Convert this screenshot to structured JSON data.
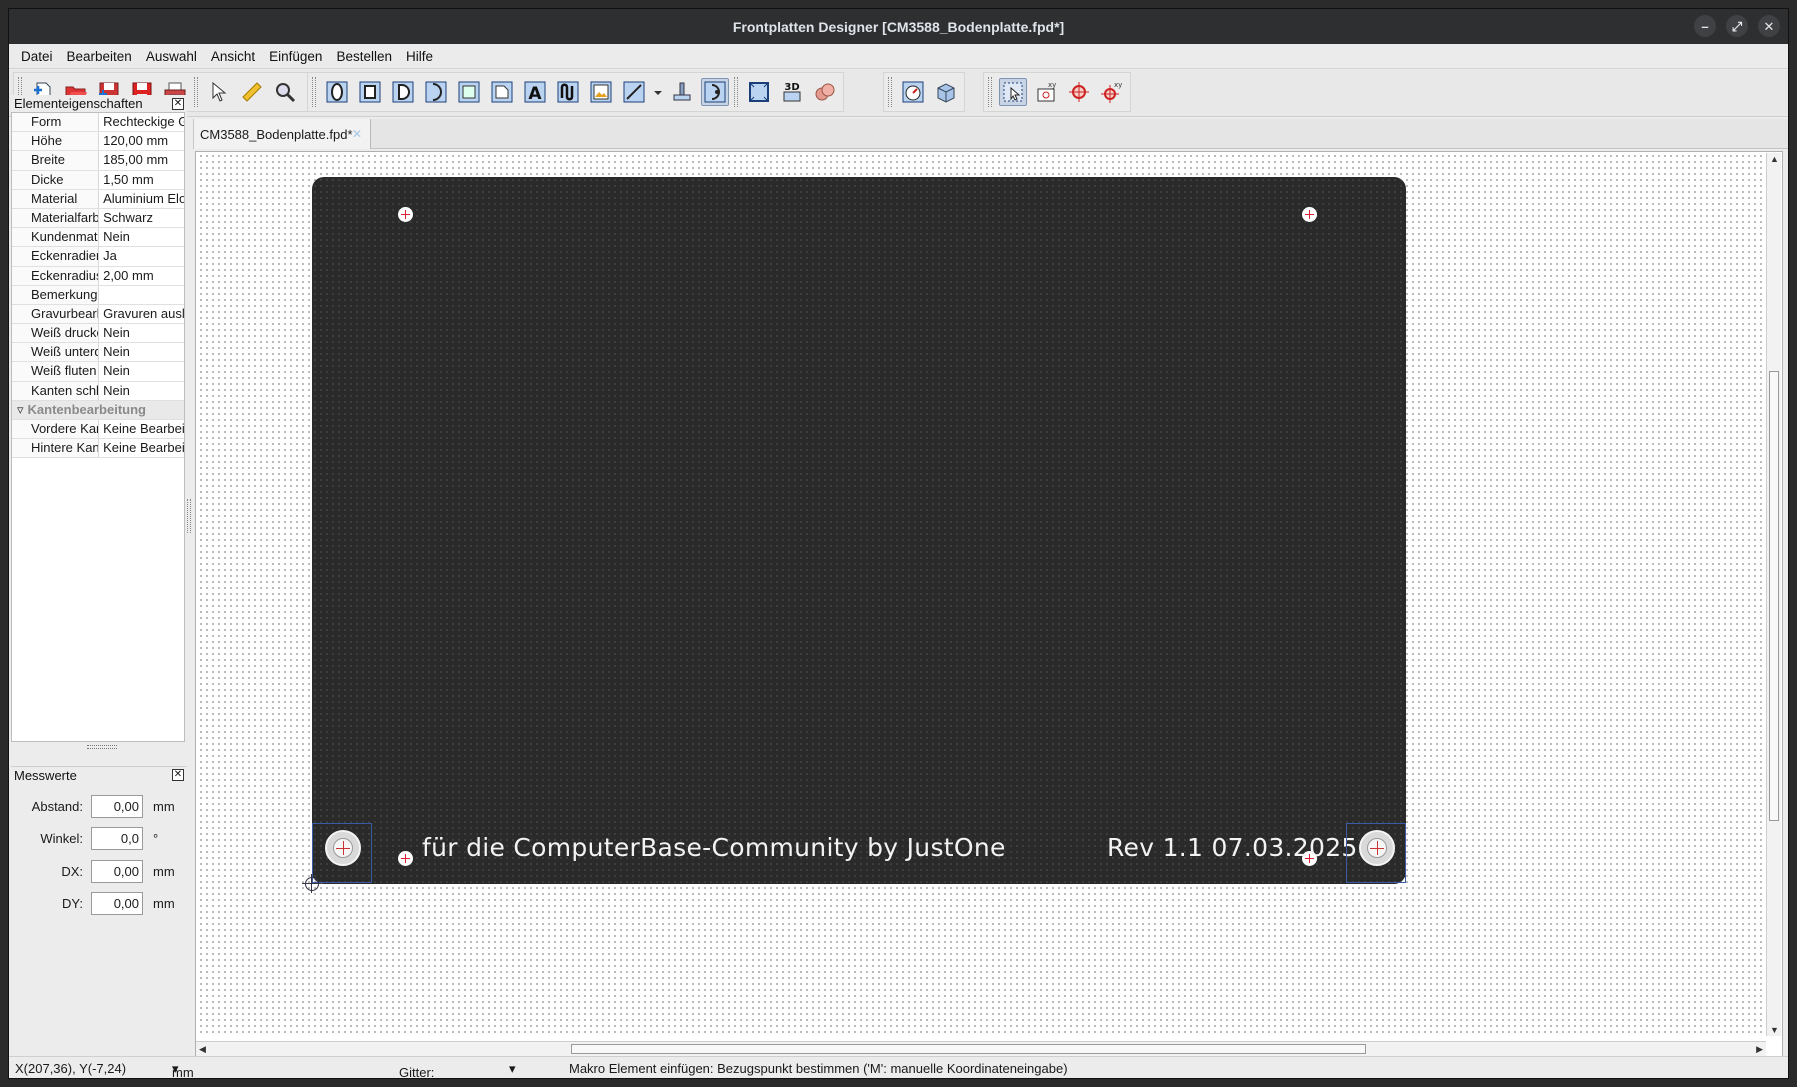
{
  "window": {
    "title": "Frontplatten Designer [CM3588_Bodenplatte.fpd*]"
  },
  "menu": [
    "Datei",
    "Bearbeiten",
    "Auswahl",
    "Ansicht",
    "Einfügen",
    "Bestellen",
    "Hilfe"
  ],
  "properties_panel": {
    "title": "Elementeigenschaften",
    "rows": [
      {
        "key": "Form",
        "value": "Rechteckige G"
      },
      {
        "key": "Höhe",
        "value": "120,00 mm"
      },
      {
        "key": "Breite",
        "value": "185,00 mm"
      },
      {
        "key": "Dicke",
        "value": "1,50 mm"
      },
      {
        "key": "Material",
        "value": "Aluminium Elox"
      },
      {
        "key": "Materialfarbe",
        "value": "Schwarz"
      },
      {
        "key": "Kundenmate",
        "value": "Nein"
      },
      {
        "key": "Eckenradien",
        "value": "Ja"
      },
      {
        "key": "Eckenradius",
        "value": "2,00 mm"
      },
      {
        "key": "Bemerkung",
        "value": ""
      },
      {
        "key": "Gravurbearb",
        "value": "Gravuren ausle"
      },
      {
        "key": "Weiß drucke",
        "value": "Nein"
      },
      {
        "key": "Weiß unterd",
        "value": "Nein"
      },
      {
        "key": "Weiß fluten",
        "value": "Nein"
      },
      {
        "key": "Kanten schle",
        "value": "Nein"
      }
    ],
    "group": "Kantenbearbeitung",
    "group_rows": [
      {
        "key": "Vordere Kan",
        "value": "Keine Bearbeit"
      },
      {
        "key": "Hintere Kant",
        "value": "Keine Bearbeit"
      }
    ]
  },
  "measure_panel": {
    "title": "Messwerte",
    "rows": [
      {
        "label": "Abstand:",
        "value": "0,00",
        "unit": "mm"
      },
      {
        "label": "Winkel:",
        "value": "0,0",
        "unit": "°"
      },
      {
        "label": "DX:",
        "value": "0,00",
        "unit": "mm"
      },
      {
        "label": "DY:",
        "value": "0,00",
        "unit": "mm"
      }
    ]
  },
  "document_tab": {
    "label": "CM3588_Bodenplatte.fpd*",
    "close": "✕"
  },
  "plate": {
    "engraving_left": "für die ComputerBase-Community by JustOne",
    "engraving_right": "Rev 1.1 07.03.2025",
    "color": "#2a2a2a"
  },
  "statusbar": {
    "coords": "X(207,36), Y(-7,24)",
    "unit": "mm",
    "grid": "Gitter: Aus",
    "message": "Makro Element einfügen: Bezugspunkt bestimmen ('M': manuelle Koordinateneingabe)"
  },
  "toolbar_icons": [
    "new-file-icon",
    "open-folder-icon",
    "save-as-icon",
    "save-icon",
    "print-icon",
    "select-pointer-icon",
    "ruler-icon",
    "zoom-icon",
    "crosshair-icon",
    "round-hole-icon",
    "rect-hole-icon",
    "d-hole-icon",
    "double-d-hole-icon",
    "square-cutout-icon",
    "polygon-cutout-icon",
    "text-icon",
    "curve-text-icon",
    "image-icon",
    "line-tool-icon",
    "bolt-icon",
    "countersink-icon",
    "plate-frame-icon",
    "view-3d-icon",
    "coins-icon",
    "gauge-icon",
    "box-3d-icon",
    "snap-select-icon",
    "snap-xy-icon",
    "snap-target-icon",
    "snap-coords-icon"
  ]
}
